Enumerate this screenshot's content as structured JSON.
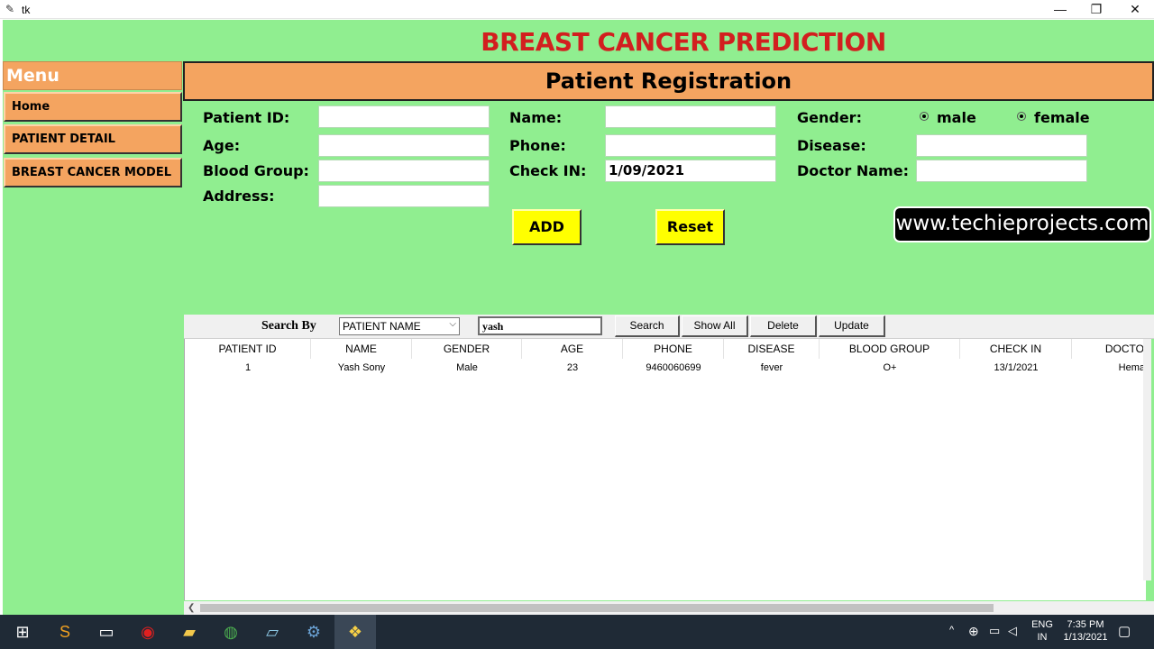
{
  "window": {
    "title": "tk",
    "minimize_icon": "—",
    "restore_icon": "❐",
    "close_icon": "✕"
  },
  "app": {
    "heading": "BREAST CANCER PREDICTION"
  },
  "menu": {
    "title": "Menu",
    "items": [
      {
        "label": "Home"
      },
      {
        "label": "PATIENT DETAIL"
      },
      {
        "label": "BREAST CANCER MODEL"
      }
    ]
  },
  "form": {
    "heading": "Patient Registration",
    "patient_id_label": "Patient ID:",
    "patient_id_value": "",
    "age_label": "Age:",
    "age_value": "",
    "blood_group_label": "Blood Group:",
    "blood_group_value": "",
    "address_label": "Address:",
    "address_value": "",
    "name_label": "Name:",
    "name_value": "",
    "phone_label": "Phone:",
    "phone_value": "",
    "check_in_label": "Check IN:",
    "check_in_value": "1/09/2021",
    "gender_label": "Gender:",
    "gender_male": "male",
    "gender_female": "female",
    "disease_label": "Disease:",
    "disease_value": "",
    "doctor_label": "Doctor Name:",
    "doctor_value": "",
    "add_button": "ADD",
    "reset_button": "Reset"
  },
  "watermark": "www.techieprojects.com",
  "search": {
    "search_by_label": "Search By",
    "search_by_selected": "PATIENT NAME",
    "query": "yash",
    "search_button": "Search",
    "show_all_button": "Show All",
    "delete_button": "Delete",
    "update_button": "Update"
  },
  "table": {
    "columns": [
      "PATIENT ID",
      "NAME",
      "GENDER",
      "AGE",
      "PHONE",
      "DISEASE",
      "BLOOD GROUP",
      "CHECK IN",
      "DOCTO"
    ],
    "rows": [
      [
        "1",
        "Yash Sony",
        "Male",
        "23",
        "9460060699",
        "fever",
        "O+",
        "13/1/2021",
        "Hema"
      ]
    ]
  },
  "taskbar": {
    "lang_top": "ENG",
    "lang_bottom": "IN",
    "time": "7:35 PM",
    "date": "1/13/2021"
  },
  "colors": {
    "app_bg": "#90ee90",
    "accent": "#f4a460",
    "title_red": "#d21f1f",
    "button_yellow": "#ffff00"
  }
}
